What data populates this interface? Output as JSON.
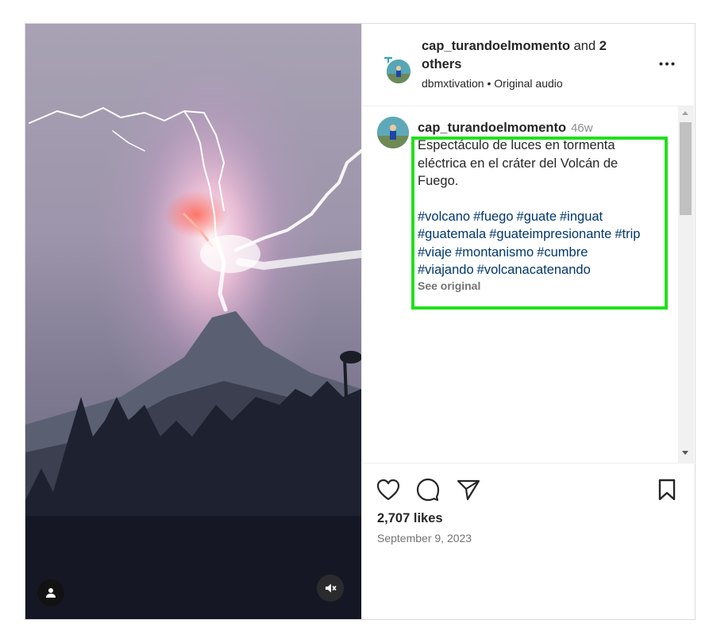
{
  "header": {
    "author": "cap_turandoelmomento",
    "and_text": " and ",
    "others": "2 others",
    "audio_author": "dbmxtivation",
    "separator": "•",
    "audio": "Original audio",
    "more_icon": "more-horizontal-icon"
  },
  "caption": {
    "username": "cap_turandoelmomento",
    "time": "46w",
    "lines": [
      "Espectáculo de luces en tormenta",
      "eléctrica en el cráter del Volcán de",
      "Fuego."
    ],
    "hashtags": [
      "#volcano",
      "#fuego",
      "#guate",
      "#inguat",
      "#guatemala",
      "#guateimpresionante",
      "#trip",
      "#viaje",
      "#montanismo",
      "#cumbre",
      "#viajando",
      "#volcanacatenando"
    ],
    "see_original": "See original"
  },
  "actions": {
    "like_icon": "heart-icon",
    "comment_icon": "comment-icon",
    "share_icon": "send-icon",
    "save_icon": "bookmark-icon"
  },
  "stats": {
    "likes": "2,707 likes",
    "date": "September 9, 2023"
  },
  "media": {
    "user_tag_icon": "user-icon",
    "mute_icon": "speaker-muted-icon"
  },
  "colors": {
    "highlight": "#21e01a",
    "hashtag": "#00376b",
    "muted_text": "#737373"
  }
}
